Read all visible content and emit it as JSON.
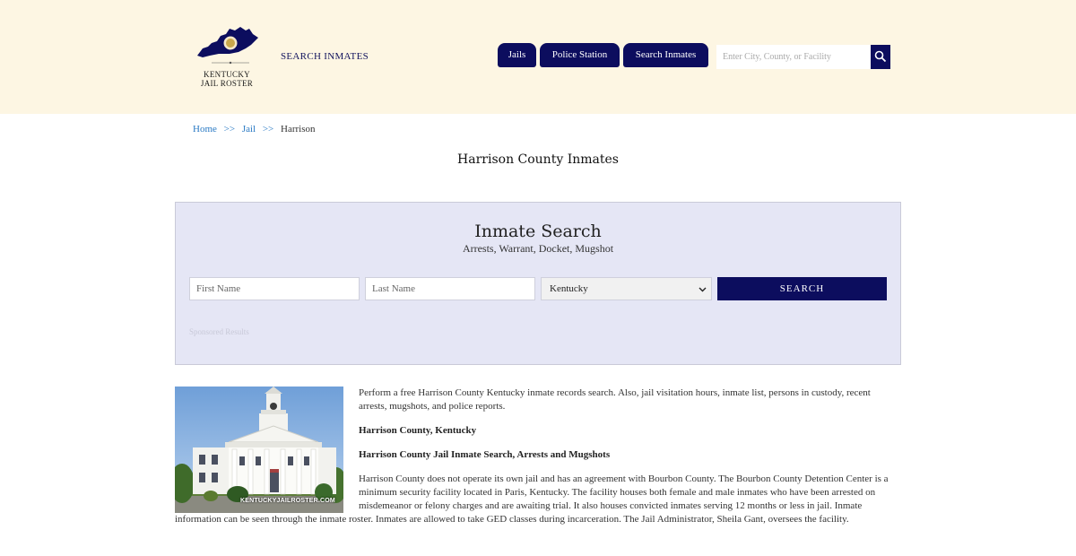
{
  "header": {
    "logo_line1": "KENTUCKY",
    "logo_line2": "JAIL ROSTER",
    "brand_link": "SEARCH INMATES",
    "nav": [
      "Jails",
      "Police Station",
      "Search Inmates"
    ],
    "search_placeholder": "Enter City, County, or Facility",
    "search_icon": "search-icon"
  },
  "breadcrumb": {
    "home": "Home",
    "sep": ">>",
    "jail": "Jail",
    "current": "Harrison"
  },
  "page_title": "Harrison County Inmates",
  "search_panel": {
    "title": "Inmate Search",
    "subtitle": "Arrests, Warrant, Docket, Mugshot",
    "first_name_placeholder": "First Name",
    "last_name_placeholder": "Last Name",
    "state_selected": "Kentucky",
    "button": "SEARCH",
    "sponsored": "Sponsored Results"
  },
  "content": {
    "image_watermark": "KENTUCKYJAILROSTER.COM",
    "intro": "Perform a free Harrison County Kentucky inmate records search. Also, jail visitation hours, inmate list, persons in custody, recent arrests, mugshots, and police reports.",
    "heading1": "Harrison County, Kentucky",
    "heading2": "Harrison County Jail Inmate Search, Arrests and Mugshots",
    "body": "Harrison County does not operate its own jail and has an agreement with Bourbon County. The Bourbon County Detention Center is a minimum security facility located in Paris, Kentucky. The facility houses both female and male inmates who have been arrested on misdemeanor or felony charges and are awaiting trial. It also houses convicted inmates serving 12 months or less in jail. Inmate information can be seen through the inmate roster. Inmates are allowed to take GED classes during incarceration. The Jail Administrator, Sheila Gant, oversees the facility."
  },
  "colors": {
    "navy": "#0c0d5e",
    "header_bg": "#fdf6e3",
    "panel_bg": "#e5e6f5",
    "link": "#2a7ac4"
  }
}
